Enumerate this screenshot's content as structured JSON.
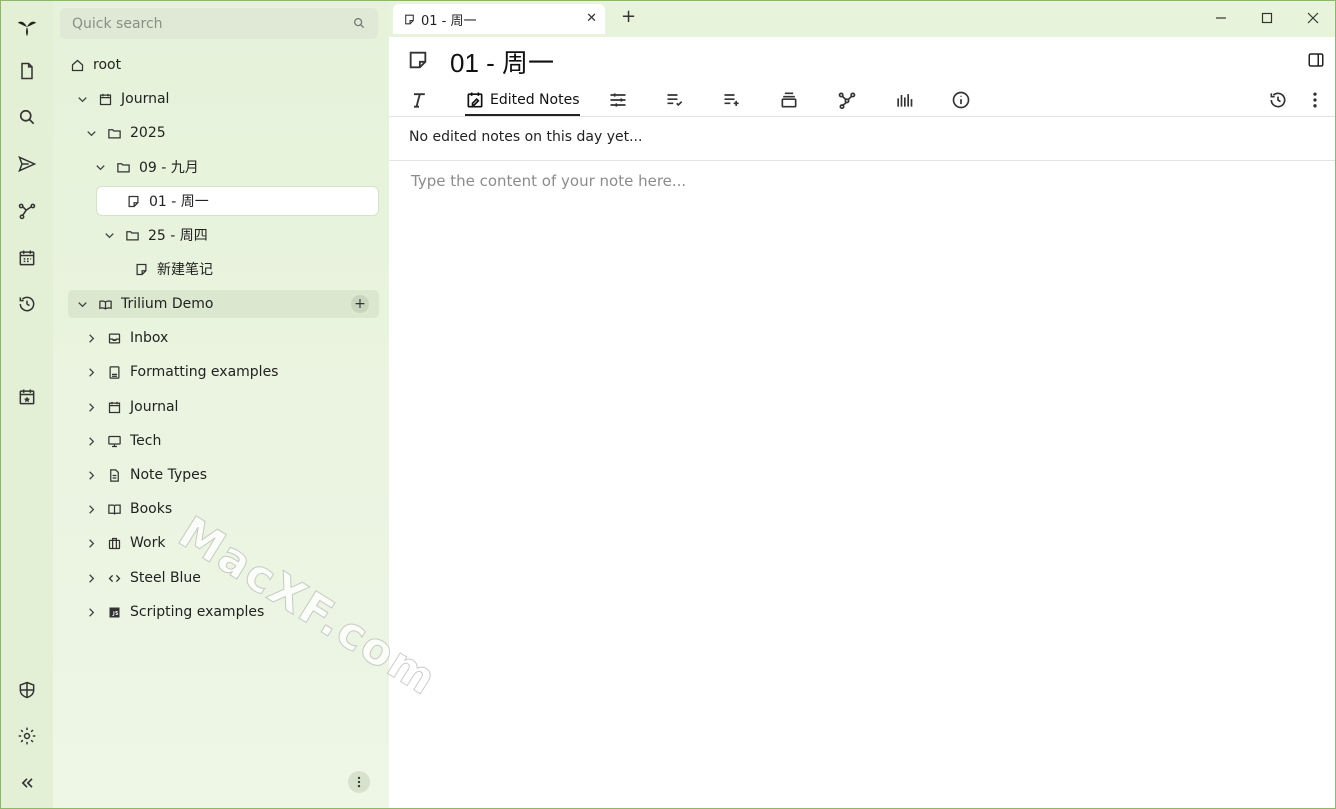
{
  "search": {
    "placeholder": "Quick search"
  },
  "tree": {
    "root": "root",
    "journal": "Journal",
    "year": "2025",
    "month": "09 - 九月",
    "day1": "01 - 周一",
    "day25": "25 - 周四",
    "newnote": "新建笔记",
    "demo": "Trilium Demo",
    "demo_children": [
      "Inbox",
      "Formatting examples",
      "Journal",
      "Tech",
      "Note Types",
      "Books",
      "Work",
      "Steel Blue",
      "Scripting examples"
    ]
  },
  "tab": {
    "title": "01 - 周一"
  },
  "note": {
    "title": "01 - 周一",
    "edited_tab_label": "Edited Notes",
    "edited_message": "No edited notes on this day yet...",
    "placeholder": "Type the content of your note here..."
  },
  "watermark": "MacXF.com",
  "colors": {
    "sidebar": "#e6f2da",
    "active_row": "#ffffff",
    "content": "#ffffff"
  }
}
